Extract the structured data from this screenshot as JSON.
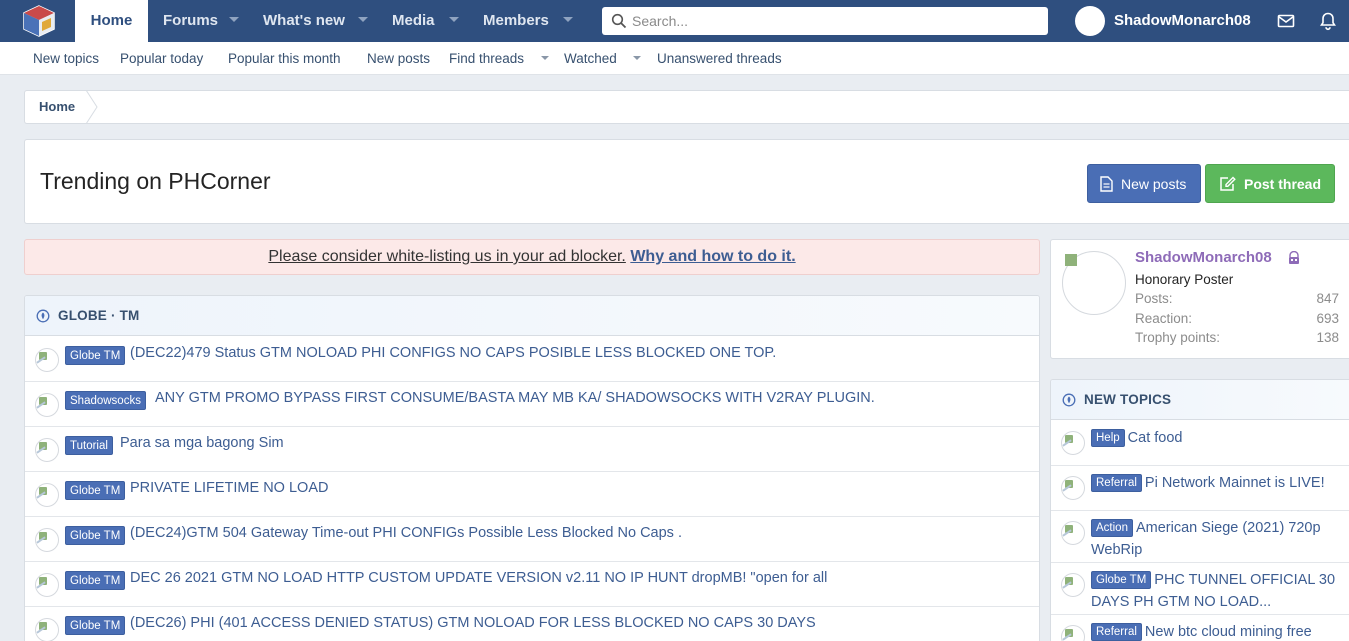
{
  "topnav": {
    "home": "Home",
    "tabs": [
      "Forums",
      "What's new",
      "Media",
      "Members"
    ],
    "search_placeholder": "Search...",
    "username": "ShadowMonarch08"
  },
  "subnav": {
    "links": [
      "New topics",
      "Popular today",
      "Popular this month",
      "New posts",
      "Find threads",
      "Watched",
      "Unanswered threads"
    ]
  },
  "breadcrumb": {
    "home": "Home"
  },
  "page": {
    "title": "Trending on PHCorner",
    "new_posts": "New posts",
    "post_thread": "Post thread"
  },
  "notice": {
    "text": "Please consider white-listing us in your ad blocker.",
    "link": "Why and how to do it."
  },
  "section": {
    "title": "GLOBE · TM",
    "threads": [
      {
        "prefix": "Globe TM",
        "title": "(DEC22)479 Status GTM NOLOAD PHI CONFIGS NO CAPS POSIBLE LESS BLOCKED ONE TOP."
      },
      {
        "prefix": "Shadowsocks",
        "title": "ANY GTM PROMO BYPASS FIRST CONSUME/BASTA MAY MB KA/ SHADOWSOCKS WITH V2RAY PLUGIN."
      },
      {
        "prefix": "Tutorial",
        "title": "Para sa mga bagong Sim"
      },
      {
        "prefix": "Globe TM",
        "title": "PRIVATE LIFETIME NO LOAD"
      },
      {
        "prefix": "Globe TM",
        "title": "(DEC24)GTM 504 Gateway Time-out PHI CONFIGs Possible Less Blocked No Caps ."
      },
      {
        "prefix": "Globe TM",
        "title": "DEC 26 2021 GTM NO LOAD HTTP CUSTOM UPDATE VERSION v2.11 NO IP HUNT dropMB! \"open for all"
      },
      {
        "prefix": "Globe TM",
        "title": "(DEC26) PHI (401 ACCESS DENIED STATUS) GTM NOLOAD FOR LESS BLOCKED NO CAPS 30 DAYS"
      }
    ]
  },
  "profile": {
    "name": "ShadowMonarch08",
    "title": "Honorary Poster",
    "stats": [
      {
        "label": "Posts:",
        "value": "847"
      },
      {
        "label": "Reaction:",
        "value": "693"
      },
      {
        "label": "Trophy points:",
        "value": "138"
      }
    ]
  },
  "new_topics": {
    "title": "NEW TOPICS",
    "items": [
      {
        "prefix": "Help",
        "title": "Cat food"
      },
      {
        "prefix": "Referral",
        "title": "Pi Network Mainnet is LIVE!"
      },
      {
        "prefix": "Action",
        "title": "American Siege (2021) 720p WebRip"
      },
      {
        "prefix": "Globe TM",
        "title": "PHC TUNNEL OFFICIAL 30 DAYS PH GTM NO LOAD..."
      },
      {
        "prefix": "Referral",
        "title": "New btc cloud mining free"
      }
    ]
  },
  "colors": {
    "nav_bg": "#2f4f7f",
    "link": "#3d5d92",
    "prefix_bg": "#4a6eb5",
    "button_green": "#5cb85c",
    "username_purple": "#8e6bb8"
  }
}
